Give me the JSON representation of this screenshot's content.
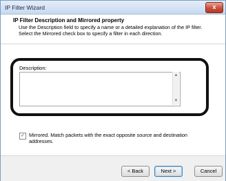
{
  "window": {
    "title": "IP Filter Wizard",
    "close_label": "x"
  },
  "header": {
    "title": "IP Filter Description and Mirrored property",
    "description_line1": "Use the Description field to specify a name or a detailed explanation of the IP filter.",
    "description_line2": "Select the Mirrored check box to specify a filter in each direction."
  },
  "description": {
    "label": "Description:",
    "value": ""
  },
  "mirrored": {
    "checked": true,
    "check_glyph": "✓",
    "label_line1": "Mirrored. Match packets with the exact opposite source and destination",
    "label_line2": "addresses."
  },
  "buttons": {
    "back": "< Back",
    "next": "Next >",
    "cancel": "Cancel"
  }
}
